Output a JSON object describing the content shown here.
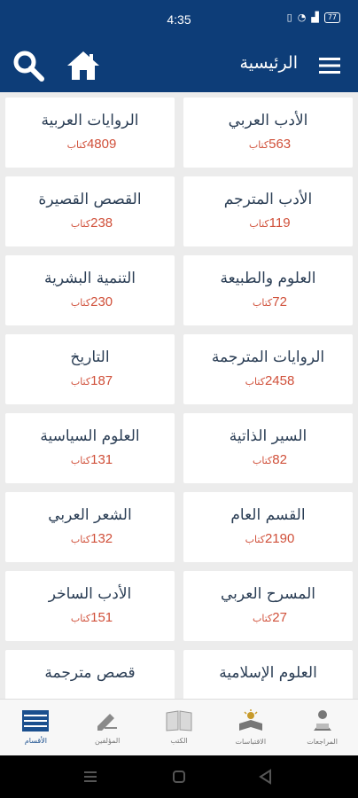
{
  "status": {
    "time": "4:35",
    "battery": "77"
  },
  "header": {
    "title": "الرئيسية"
  },
  "categories": [
    {
      "title": "الأدب العربي",
      "count": "563",
      "unit": "كتاب"
    },
    {
      "title": "الروايات العربية",
      "count": "4809",
      "unit": "كتاب"
    },
    {
      "title": "الأدب المترجم",
      "count": "119",
      "unit": "كتاب"
    },
    {
      "title": "القصص القصيرة",
      "count": "238",
      "unit": "كتاب"
    },
    {
      "title": "العلوم والطبيعة",
      "count": "72",
      "unit": "كتاب"
    },
    {
      "title": "التنمية البشرية",
      "count": "230",
      "unit": "كتاب"
    },
    {
      "title": "الروايات المترجمة",
      "count": "2458",
      "unit": "كتاب"
    },
    {
      "title": "التاريخ",
      "count": "187",
      "unit": "كتاب"
    },
    {
      "title": "السير الذاتية",
      "count": "82",
      "unit": "كتاب"
    },
    {
      "title": "العلوم السياسية",
      "count": "131",
      "unit": "كتاب"
    },
    {
      "title": "القسم العام",
      "count": "2190",
      "unit": "كتاب"
    },
    {
      "title": "الشعر العربي",
      "count": "132",
      "unit": "كتاب"
    },
    {
      "title": "المسرح العربي",
      "count": "27",
      "unit": "كتاب"
    },
    {
      "title": "الأدب الساخر",
      "count": "151",
      "unit": "كتاب"
    },
    {
      "title": "العلوم الإسلامية",
      "count": "",
      "unit": ""
    },
    {
      "title": "قصص مترجمة",
      "count": "",
      "unit": ""
    }
  ],
  "bottom_nav": [
    {
      "label": "الأقسام",
      "icon": "sections-icon",
      "active": true
    },
    {
      "label": "المؤلفين",
      "icon": "authors-icon",
      "active": false
    },
    {
      "label": "الكتب",
      "icon": "books-icon",
      "active": false
    },
    {
      "label": "الاقتباسات",
      "icon": "quotes-icon",
      "active": false
    },
    {
      "label": "المراجعات",
      "icon": "reviews-icon",
      "active": false
    }
  ],
  "colors": {
    "primary": "#0d3d78",
    "count": "#d0503a",
    "title": "#2b3e55"
  }
}
